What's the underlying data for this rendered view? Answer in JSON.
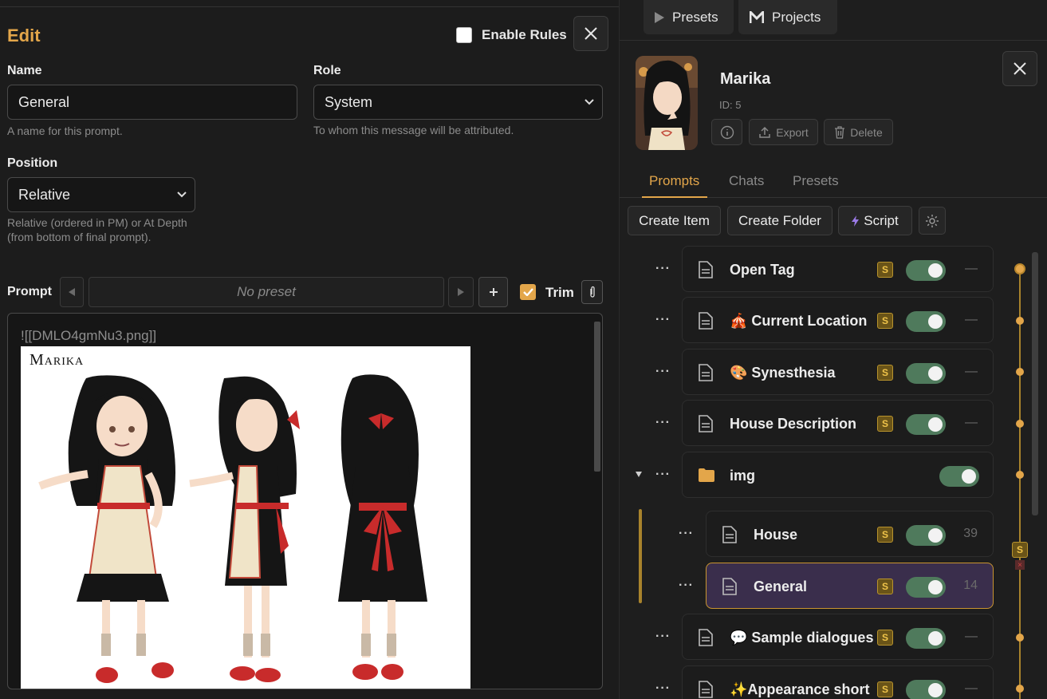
{
  "edit": {
    "title": "Edit",
    "enable_rules_label": "Enable Rules",
    "name_label": "Name",
    "name_value": "General",
    "name_hint": "A name for this prompt.",
    "role_label": "Role",
    "role_value": "System",
    "role_hint": "To whom this message will be attributed.",
    "position_label": "Position",
    "position_value": "Relative",
    "position_hint_1": "Relative (ordered in PM) or At Depth",
    "position_hint_2": "(from bottom of final prompt).",
    "prompt_label": "Prompt",
    "preset_value": "No preset",
    "trim_label": "Trim",
    "prompt_text": "![[DMLO4gmNu3.png]]",
    "sheet_title": "Marika"
  },
  "top_tabs": {
    "presets": "Presets",
    "projects": "Projects"
  },
  "character": {
    "name": "Marika",
    "id": "ID: 5",
    "export_label": "Export",
    "delete_label": "Delete"
  },
  "tabs": {
    "prompts": "Prompts",
    "chats": "Chats",
    "presets": "Presets"
  },
  "toolbar": {
    "create_item": "Create Item",
    "create_folder": "Create Folder",
    "script": "Script"
  },
  "items": [
    {
      "label": "Open Tag",
      "badge": "S",
      "count": "—"
    },
    {
      "label": "🎪 Current Location",
      "badge": "S",
      "count": "—"
    },
    {
      "label": "🎨 Synesthesia",
      "badge": "S",
      "count": "—"
    },
    {
      "label": "House Description",
      "badge": "S",
      "count": "—"
    },
    {
      "label": "img"
    },
    {
      "label": "House",
      "badge": "S",
      "count": "39"
    },
    {
      "label": "General",
      "badge": "S",
      "count": "14"
    },
    {
      "label": "💬 Sample dialogues",
      "badge": "S",
      "count": "—"
    },
    {
      "label": "✨Appearance short",
      "badge": "S",
      "count": "—"
    }
  ],
  "timeline_badge": "S",
  "colors": {
    "accent": "#e3a64a",
    "toggle_on": "#4f7a5c",
    "selected_bg": "#3a2e4c"
  }
}
